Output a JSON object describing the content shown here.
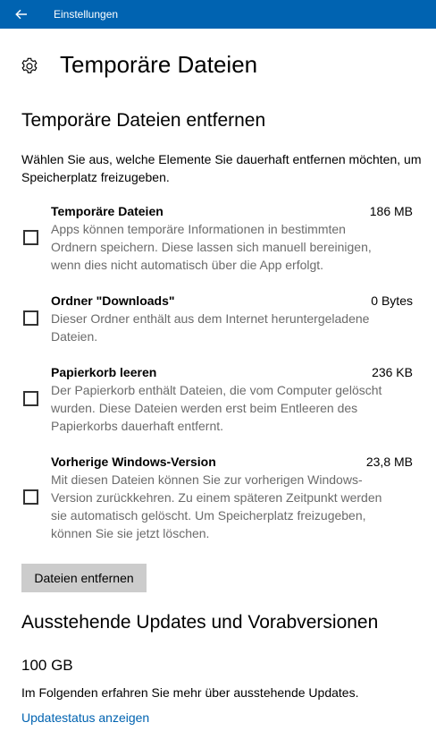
{
  "titlebar": {
    "title": "Einstellungen",
    "back_icon": "arrow-left-icon",
    "color": "#0063b1"
  },
  "header": {
    "title": "Temporäre Dateien",
    "icon": "gear-icon"
  },
  "remove_section": {
    "heading": "Temporäre Dateien entfernen",
    "intro": "Wählen Sie aus, welche Elemente Sie dauerhaft entfernen möchten, um Speicherplatz freizugeben.",
    "items": [
      {
        "name": "Temporäre Dateien",
        "size": "186 MB",
        "checked": false,
        "desc": [
          "Apps können temporäre Informationen in bestimmten",
          "Ordnern speichern. Diese lassen sich manuell bereinigen,",
          "wenn dies nicht automatisch über die App erfolgt."
        ]
      },
      {
        "name": "Ordner \"Downloads\"",
        "size": "0 Bytes",
        "checked": false,
        "desc": [
          "Dieser Ordner enthält aus dem Internet heruntergeladene",
          "Dateien."
        ]
      },
      {
        "name": "Papierkorb leeren",
        "size": "236 KB",
        "checked": false,
        "desc": [
          "Der Papierkorb enthält Dateien, die vom Computer gelöscht",
          "wurden. Diese Dateien werden erst beim Entleeren des",
          "Papierkorbs dauerhaft entfernt."
        ]
      },
      {
        "name": "Vorherige Windows-Version",
        "size": "23,8 MB",
        "checked": false,
        "desc": [
          "Mit diesen Dateien können Sie zur vorherigen Windows-",
          "Version zurückkehren. Zu einem späteren Zeitpunkt werden",
          "sie automatisch gelöscht. Um Speicherplatz freizugeben,",
          "können Sie sie jetzt löschen."
        ]
      }
    ],
    "button_label": "Dateien entfernen"
  },
  "updates_section": {
    "heading": "Ausstehende Updates und Vorabversionen",
    "size": "100 GB",
    "info": "Im Folgenden erfahren Sie mehr über ausstehende Updates.",
    "link": "Updatestatus anzeigen"
  }
}
